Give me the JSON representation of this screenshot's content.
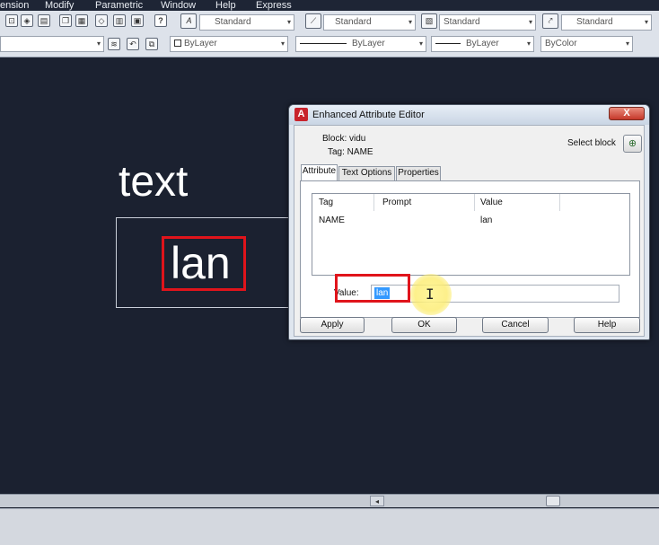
{
  "menu": [
    "ension",
    "Modify",
    "Parametric",
    "Window",
    "Help",
    "Express"
  ],
  "toolbar": {
    "text_style": "Standard",
    "dim_style": "Standard",
    "table_style": "Standard",
    "mleader_style": "Standard",
    "color": "ByLayer",
    "linetype": "ByLayer",
    "lineweight": "ByLayer",
    "plotstyle": "ByColor",
    "help_glyph": "?"
  },
  "drawing": {
    "text": "text",
    "attribute_value": "lan"
  },
  "dialog": {
    "title": "Enhanced Attribute Editor",
    "app_glyph": "A",
    "close_glyph": "X",
    "block_label": "Block: vidu",
    "tag_label": "Tag: NAME",
    "select_block": "Select block",
    "tabs": [
      "Attribute",
      "Text Options",
      "Properties"
    ],
    "columns": [
      "Tag",
      "Prompt",
      "Value"
    ],
    "rows": [
      {
        "tag": "NAME",
        "prompt": "",
        "value": "lan"
      }
    ],
    "value_label": "Value:",
    "value_input": "lan",
    "buttons": {
      "apply": "Apply",
      "ok": "OK",
      "cancel": "Cancel",
      "help": "Help"
    }
  },
  "colors": {
    "canvas": "#1b2130",
    "highlight": "#e0141b",
    "selection": "#3399ff"
  }
}
